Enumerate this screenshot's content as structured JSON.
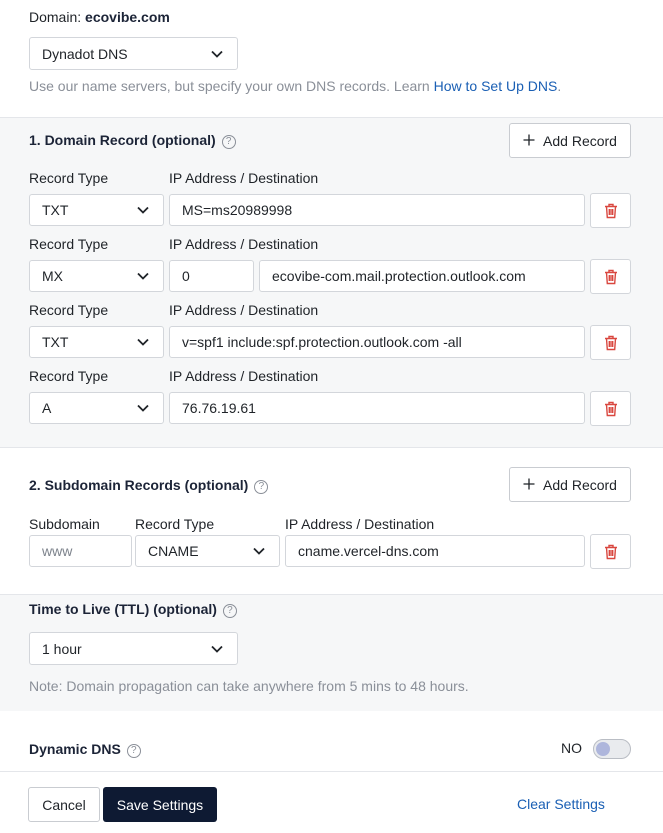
{
  "header": {
    "domain_label": "Domain:",
    "domain_name": "ecovibe.com",
    "dns_select": "Dynadot DNS",
    "note_prefix": "Use our name servers, but specify your own DNS records. Learn",
    "note_link": "How to Set Up DNS",
    "note_suffix": "."
  },
  "domain_records": {
    "title": "1. Domain Record (optional)",
    "add_button": "Add Record",
    "type_label": "Record Type",
    "dest_label": "IP Address / Destination",
    "rows": [
      {
        "type": "TXT",
        "value": "MS=ms20989998"
      },
      {
        "type": "MX",
        "priority": "0",
        "value": "ecovibe-com.mail.protection.outlook.com"
      },
      {
        "type": "TXT",
        "value": "v=spf1 include:spf.protection.outlook.com -all"
      },
      {
        "type": "A",
        "value": "76.76.19.61"
      }
    ]
  },
  "subdomain_records": {
    "title": "2. Subdomain Records (optional)",
    "add_button": "Add Record",
    "subdomain_label": "Subdomain",
    "type_label": "Record Type",
    "dest_label": "IP Address / Destination",
    "rows": [
      {
        "subdomain_placeholder": "www",
        "type": "CNAME",
        "value": "cname.vercel-dns.com"
      }
    ]
  },
  "ttl": {
    "title": "Time to Live (TTL) (optional)",
    "select": "1 hour",
    "note": "Note: Domain propagation can take anywhere from 5 mins to 48 hours."
  },
  "dynamic_dns": {
    "title": "Dynamic DNS",
    "state_label": "NO",
    "enabled": false
  },
  "footer": {
    "cancel": "Cancel",
    "save": "Save Settings",
    "clear": "Clear Settings"
  },
  "colors": {
    "primary": "#0e1a33",
    "link": "#1a5fb4",
    "delete": "#d9473f",
    "section_bg": "#f6f7f8"
  },
  "icons": {
    "help": "question-circle-icon",
    "add": "plus-icon",
    "delete": "trash-icon",
    "select": "chevron-down-icon"
  }
}
